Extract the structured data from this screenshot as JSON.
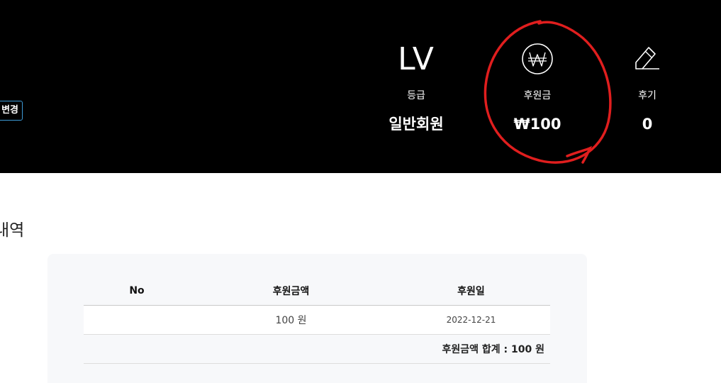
{
  "header": {
    "change_label": "변경",
    "stats": {
      "grade": {
        "big": "LV",
        "label": "등급",
        "value": "일반회원"
      },
      "donation": {
        "icon": "won-circle-icon",
        "label": "후원금",
        "value": "₩100"
      },
      "review": {
        "icon": "pencil-icon",
        "label": "후기",
        "value": "0"
      }
    }
  },
  "section": {
    "title": "내역"
  },
  "history": {
    "columns": [
      "No",
      "후원금액",
      "후원일"
    ],
    "rows": [
      {
        "no": "",
        "amount": "100 원",
        "date": "2022-12-21"
      }
    ],
    "total": "후원금액 합계 : 100 원"
  },
  "colors": {
    "header_bg": "#000000",
    "card_bg": "#f7f8fa",
    "annotation": "#e01e1e",
    "button_border": "#3d9ad6"
  }
}
